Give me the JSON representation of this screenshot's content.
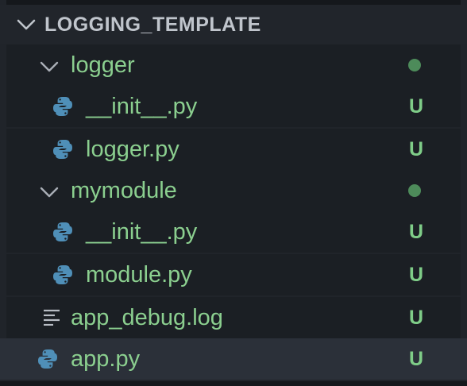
{
  "explorer": {
    "section_title": "LOGGING_TEMPLATE",
    "items": [
      {
        "label": "logger",
        "type": "folder",
        "expanded": true,
        "status": "",
        "status_dot": true
      },
      {
        "label": "__init__.py",
        "type": "python-file",
        "status": "U"
      },
      {
        "label": "logger.py",
        "type": "python-file",
        "status": "U"
      },
      {
        "label": "mymodule",
        "type": "folder",
        "expanded": true,
        "status": "",
        "status_dot": true
      },
      {
        "label": "__init__.py",
        "type": "python-file",
        "status": "U"
      },
      {
        "label": "module.py",
        "type": "python-file",
        "status": "U"
      },
      {
        "label": "app_debug.log",
        "type": "log-file",
        "status": "U"
      },
      {
        "label": "app.py",
        "type": "python-file",
        "status": "U",
        "selected": true
      }
    ]
  },
  "colors": {
    "background": "#20242a",
    "label_untracked": "#8bcf8f",
    "status_untracked": "#7fcd88",
    "modified_dot": "#4d8b5a",
    "selected_row": "#2b3039",
    "python_icon": "#4f8fb8"
  },
  "icons": {
    "section_toggle": "chevron-down-icon",
    "folder_toggle": "chevron-down-icon",
    "python_file": "python-icon",
    "log_file": "lines-icon"
  }
}
